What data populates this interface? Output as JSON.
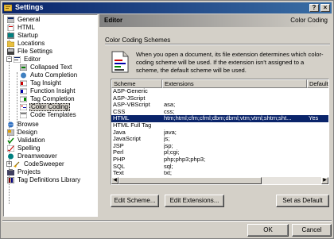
{
  "window": {
    "title": "Settings"
  },
  "tree": {
    "items": [
      {
        "label": "General",
        "icon": "general-icon"
      },
      {
        "label": "HTML",
        "icon": "html-icon"
      },
      {
        "label": "Startup",
        "icon": "startup-icon"
      },
      {
        "label": "Locations",
        "icon": "folder-icon"
      },
      {
        "label": "File Settings",
        "icon": "file-icon"
      },
      {
        "label": "Editor",
        "icon": "editor-icon"
      },
      {
        "label": "Collapsed Text",
        "icon": "collapse-icon"
      },
      {
        "label": "Auto Completion",
        "icon": "auto-icon"
      },
      {
        "label": "Tag Insight",
        "icon": "insight-icon"
      },
      {
        "label": "Function Insight",
        "icon": "function-icon"
      },
      {
        "label": "Tag Completion",
        "icon": "tag-icon"
      },
      {
        "label": "Color Coding",
        "icon": "color-icon"
      },
      {
        "label": "Code Templates",
        "icon": "template-icon"
      },
      {
        "label": "Browse",
        "icon": "browse-icon"
      },
      {
        "label": "Design",
        "icon": "design-icon"
      },
      {
        "label": "Validation",
        "icon": "validation-icon"
      },
      {
        "label": "Spelling",
        "icon": "spelling-icon"
      },
      {
        "label": "Dreamweaver",
        "icon": "dreamweaver-icon"
      },
      {
        "label": "CodeSweeper",
        "icon": "sweeper-icon"
      },
      {
        "label": "Projects",
        "icon": "projects-icon"
      },
      {
        "label": "Tag Definitions Library",
        "icon": "library-icon"
      }
    ],
    "expander_expanded": "−",
    "expander_collapsed": "+"
  },
  "header": {
    "title": "Editor",
    "subtitle": "Color Coding"
  },
  "section": {
    "label": "Color Coding Schemes"
  },
  "description": "When you open a document, its file extension determines which color-coding scheme will be used. If the extension isn't assigned to a scheme, the default scheme will be used.",
  "list": {
    "columns": [
      "Scheme",
      "Extensions",
      "Default?"
    ],
    "rows": [
      {
        "scheme": "ASP-Generic",
        "ext": "",
        "def": ""
      },
      {
        "scheme": "ASP-JScript",
        "ext": "",
        "def": ""
      },
      {
        "scheme": "ASP-VBScript",
        "ext": "asa;",
        "def": ""
      },
      {
        "scheme": "CSS",
        "ext": "css;",
        "def": ""
      },
      {
        "scheme": "HTML",
        "ext": "htm;html;cfm;cfml;dbm;dbml;vtm;vtml;shtm;sht...",
        "def": "Yes"
      },
      {
        "scheme": "HTML Full Tag",
        "ext": "",
        "def": ""
      },
      {
        "scheme": "Java",
        "ext": "java;",
        "def": ""
      },
      {
        "scheme": "JavaScript",
        "ext": "js;",
        "def": ""
      },
      {
        "scheme": "JSP",
        "ext": "jsp;",
        "def": ""
      },
      {
        "scheme": "Perl",
        "ext": "pl;cgi;",
        "def": ""
      },
      {
        "scheme": "PHP",
        "ext": "php;php3;php3;",
        "def": ""
      },
      {
        "scheme": "SQL",
        "ext": "sql;",
        "def": ""
      },
      {
        "scheme": "Text",
        "ext": "txt;",
        "def": ""
      }
    ],
    "selected_index": 4,
    "scroll_left_arrow": "◀",
    "scroll_right_arrow": "▶"
  },
  "buttons": {
    "edit_scheme": "Edit Scheme...",
    "edit_extensions": "Edit Extensions...",
    "set_default": "Set as Default",
    "ok": "OK",
    "cancel": "Cancel"
  },
  "titlebar_buttons": {
    "help": "?",
    "close": "×"
  },
  "colors": {
    "selection": "#0a246a",
    "titlebar": "#0a246a",
    "face": "#d4d0c8"
  }
}
